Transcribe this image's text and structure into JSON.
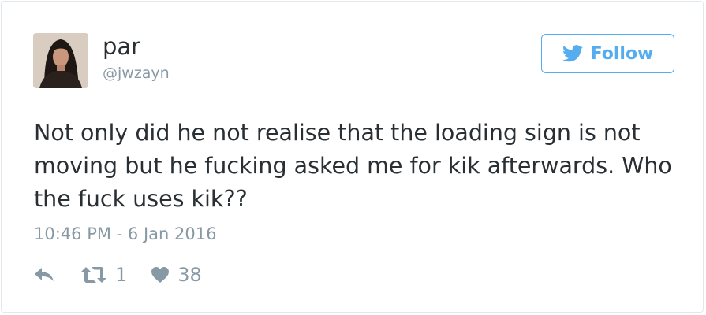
{
  "author": {
    "display_name": "par",
    "handle": "@jwzayn",
    "avatar_icon": "profile-photo"
  },
  "follow_button": {
    "label": "Follow",
    "icon": "twitter-bird-icon"
  },
  "tweet": {
    "text": "Not only did he not realise that the loading sign is not moving but he fucking asked me for kik afterwards. Who the fuck uses kik??",
    "timestamp": "10:46 PM - 6 Jan 2016"
  },
  "actions": {
    "reply_icon": "reply-icon",
    "retweet_icon": "retweet-icon",
    "retweet_count": "1",
    "like_icon": "heart-icon",
    "like_count": "38"
  },
  "colors": {
    "accent": "#55acee",
    "text": "#292f33",
    "muted": "#8899a6",
    "border": "#e1e8ed"
  }
}
